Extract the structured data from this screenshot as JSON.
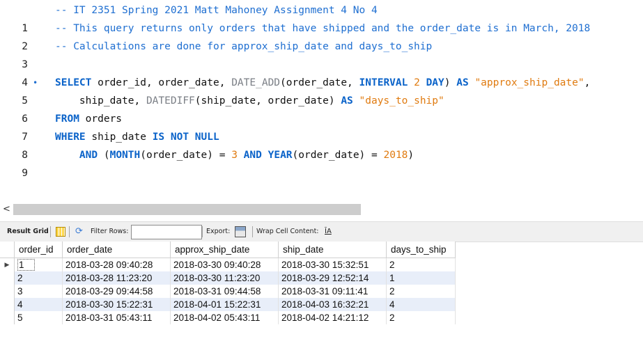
{
  "editor": {
    "line_numbers": [
      "1",
      "2",
      "3",
      "4",
      "5",
      "6",
      "7",
      "8",
      "9"
    ],
    "comments": {
      "l1": "-- IT 2351 Spring 2021 Matt Mahoney Assignment 4 No 4",
      "l2": "-- This query returns only orders that have shipped and the order_date is in March, 2018",
      "l3": "-- Calculations are done for approx_ship_date and days_to_ship"
    },
    "breakpoint_marker": "•",
    "tokens": {
      "select": "SELECT",
      "l5_t1": " order_id, order_date, ",
      "date_add": "DATE_ADD",
      "l5_t2": "(order_date, ",
      "interval": "INTERVAL",
      "sp": " ",
      "two": "2",
      "day": "DAY",
      "l5_t3": ") ",
      "as": "AS",
      "approx_str": "\"approx_ship_date\"",
      "comma": ",",
      "l6_t1": "    ship_date, ",
      "datediff": "DATEDIFF",
      "l6_t2": "(ship_date, order_date) ",
      "days_str": "\"days_to_ship\"",
      "from": "FROM",
      "orders": " orders",
      "where": "WHERE",
      "l8_t1": " ship_date ",
      "is_not_null": "IS NOT NULL",
      "indent": "    ",
      "and": "AND",
      "l9_t1": " (",
      "month": "MONTH",
      "l9_t2": "(order_date) = ",
      "three": "3",
      "year": "YEAR",
      "l9_t3": "(order_date) = ",
      "y2018": "2018",
      "close": ")"
    }
  },
  "scrollbar": {
    "left_arrow": "<"
  },
  "toolbar": {
    "result_grid": "Result Grid",
    "filter_icon": "⟳",
    "filter_label": "Filter Rows:",
    "filter_value": "",
    "export_label": "Export:",
    "wrap_label": "Wrap Cell Content:",
    "wrap_icon": "ĪA",
    "icons": [
      "grid-icon",
      "filter-refresh-icon",
      "export-icon",
      "wrap-cell-icon"
    ]
  },
  "grid": {
    "current_row_marker": "▶",
    "columns": [
      "order_id",
      "order_date",
      "approx_ship_date",
      "ship_date",
      "days_to_ship"
    ],
    "rows": [
      [
        "1",
        "2018-03-28 09:40:28",
        "2018-03-30 09:40:28",
        "2018-03-30 15:32:51",
        "2"
      ],
      [
        "2",
        "2018-03-28 11:23:20",
        "2018-03-30 11:23:20",
        "2018-03-29 12:52:14",
        "1"
      ],
      [
        "3",
        "2018-03-29 09:44:58",
        "2018-03-31 09:44:58",
        "2018-03-31 09:11:41",
        "2"
      ],
      [
        "4",
        "2018-03-30 15:22:31",
        "2018-04-01 15:22:31",
        "2018-04-03 16:32:21",
        "4"
      ],
      [
        "5",
        "2018-03-31 05:43:11",
        "2018-04-02 05:43:11",
        "2018-04-02 14:21:12",
        "2"
      ]
    ]
  },
  "colors": {
    "comment": "#1f6fd1",
    "keyword": "#0b63c9",
    "function": "#7b7f86",
    "string": "#e07b10",
    "alt_row": "#e8eef9"
  }
}
